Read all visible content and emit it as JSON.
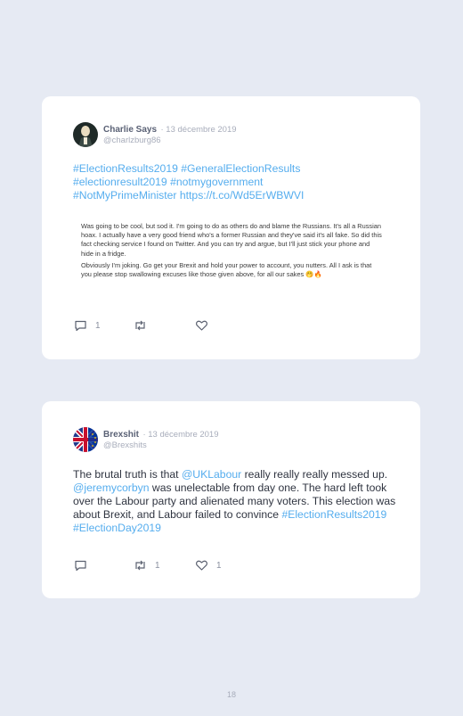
{
  "tweets": [
    {
      "author": "Charlie Says",
      "date": "· 13 décembre 2019",
      "handle": "@charlzburg86",
      "hashtag_lines": [
        "#ElectionResults2019 #GeneralElectionResults",
        "#electionresult2019 #notmygovernment",
        "#NotMyPrimeMinister https://t.co/Wd5ErWBWVI"
      ],
      "quoted_paragraphs": [
        "Was going to be cool, but sod it. I'm going to do as others do and blame the Russians. It's all a Russian hoax. I actually have a very good friend who's a former Russian and they've said it's all fake. So did this fact checking service I found on Twitter. And you can try and argue, but I'll just stick your phone and hide in a fridge.",
        "Obviously I'm joking. Go get your Brexit and hold your power to account, you nutters. All I ask is that you please stop swallowing excuses like those given above, for all our sakes 🤭🔥"
      ],
      "replies": "1",
      "retweets": "",
      "likes": ""
    },
    {
      "author": "Brexshit",
      "date": "· 13 décembre 2019",
      "handle": "@Brexshits",
      "text_1": "The brutal truth is that ",
      "mention_1": "@UKLabour",
      "text_2": " really really really messed up. ",
      "mention_2": "@jeremycorbyn",
      "text_3": " was unelectable from day one. The hard left took over the Labour party and alienated many voters. This election was about Brexit, and Labour failed to convince ",
      "hashtags": "#ElectionResults2019 #ElectionDay2019",
      "replies": "",
      "retweets": "1",
      "likes": "1"
    }
  ],
  "page_number": "18",
  "icons": [
    "reply-icon",
    "retweet-icon",
    "like-icon"
  ],
  "colors": {
    "link": "#55adee",
    "background": "#e6eaf3",
    "card": "#ffffff"
  }
}
